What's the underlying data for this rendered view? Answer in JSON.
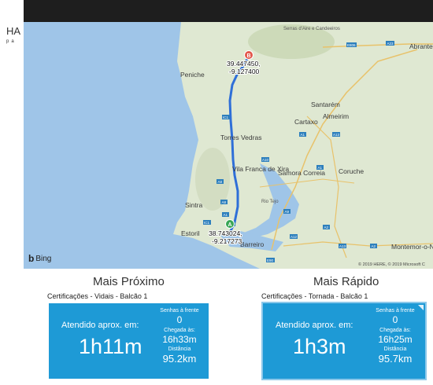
{
  "brand": {
    "main": "HA",
    "sub": "pa"
  },
  "map": {
    "provider": "Bing",
    "copyright": "© 2019 HERE, © 2019 Microsoft C",
    "route_color": "#2f6fd8",
    "water_color": "#9fc5e8",
    "land_color": "#dfe8d2",
    "places": [
      "Serras d'Aire e Candeeiros",
      "Abrantes",
      "Peniche",
      "Santarém",
      "Almeirim",
      "Cartaxo",
      "Torres Vedras",
      "Vila Franca de Xira",
      "Samora Correia",
      "Coruche",
      "Sintra",
      "Rio Tejo",
      "Estoril",
      "Barreiro",
      "Montemor-o-N"
    ],
    "start": {
      "marker": "A",
      "lat": "38.743024,",
      "lon": "-9.217273"
    },
    "end": {
      "marker": "B",
      "lat": "39.447450,",
      "lon": "-9.127400"
    },
    "shields": [
      "A1",
      "A8",
      "A8",
      "IC1",
      "A23",
      "E806",
      "A13",
      "A10",
      "A9",
      "A1",
      "A2",
      "A13",
      "A12",
      "A2",
      "E90",
      "A9",
      "IC1",
      "A1"
    ]
  },
  "cards": [
    {
      "title": "Mais Próximo",
      "subtitle": "Certificações - Vidais - Balcão 1",
      "served_label": "Atendido aprox. em:",
      "served_time": "1h11m",
      "ahead_label": "Senhas à frente",
      "ahead_value": "0",
      "arrival_label": "Chegada às:",
      "arrival_value": "16h33m",
      "distance_label": "Distância",
      "distance_value": "95.2km"
    },
    {
      "title": "Mais Rápido",
      "subtitle": "Certificações - Tornada - Balcão 1",
      "served_label": "Atendido aprox. em:",
      "served_time": "1h3m",
      "ahead_label": "Senhas à frente",
      "ahead_value": "0",
      "arrival_label": "Chegada às:",
      "arrival_value": "16h25m",
      "distance_label": "Distância",
      "distance_value": "95.7km"
    }
  ],
  "tile_color": "#1e9ad6"
}
